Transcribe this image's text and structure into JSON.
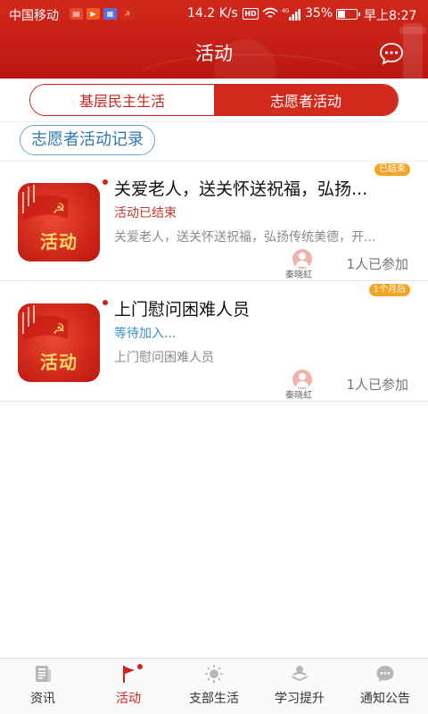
{
  "status_bar": {
    "carrier": "中国移动",
    "speed": "14.2 K/s",
    "hd": "HD",
    "network": "4G",
    "battery_pct": "35%",
    "battery_level": 0.35,
    "time": "早上8:27"
  },
  "header": {
    "title": "活动",
    "chat_icon": "chat-bubble-icon"
  },
  "tabs": [
    {
      "label": "基层民主生活",
      "active": false
    },
    {
      "label": "志愿者活动",
      "active": true
    }
  ],
  "records_label": "志愿者活动记录",
  "activities": [
    {
      "title": "关爱老人，送关怀送祝福，弘扬...",
      "status": "活动已结束",
      "status_color": "#c0392b",
      "description": "关爱老人，送关怀送祝福，弘扬传统美德，开...",
      "badge": "已结束",
      "thumb_text": "活动",
      "avatar_name": "秦晓虹",
      "joined": "1人已参加"
    },
    {
      "title": "上门慰问困难人员",
      "status": "等待加入...",
      "status_color": "#3b8fc4",
      "description": "上门慰问困难人员",
      "badge": "1个月后",
      "thumb_text": "活动",
      "avatar_name": "秦晓虹",
      "joined": "1人已参加"
    }
  ],
  "bottom_nav": [
    {
      "label": "资讯",
      "icon": "news-icon",
      "active": false
    },
    {
      "label": "活动",
      "icon": "flag-icon",
      "active": true
    },
    {
      "label": "支部生活",
      "icon": "sun-icon",
      "active": false
    },
    {
      "label": "学习提升",
      "icon": "learning-icon",
      "active": false
    },
    {
      "label": "通知公告",
      "icon": "notice-chat-icon",
      "active": false
    }
  ],
  "colors": {
    "primary_red": "#d32a1e",
    "accent_blue": "#3b8fc4",
    "badge_orange": "#f2a524"
  }
}
